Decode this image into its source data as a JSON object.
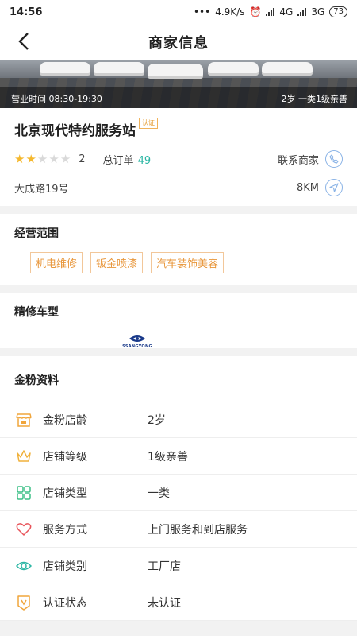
{
  "status": {
    "time": "14:56",
    "dots": "•••",
    "speed": "4.9K/s",
    "network1": "4G",
    "network2": "3G",
    "battery": "73"
  },
  "nav": {
    "title": "商家信息"
  },
  "banner": {
    "hours": "营业时间 08:30-19:30",
    "tag": "2岁 一类1级亲善"
  },
  "shop": {
    "name": "北京现代特约服务站",
    "cert_badge": "认证",
    "rating": "2",
    "stars_filled": 2,
    "stars_total": 5,
    "orders_label": "总订单",
    "orders": "49",
    "contact_label": "联系商家",
    "address": "大成路19号",
    "distance": "8KM"
  },
  "scope": {
    "title": "经营范围",
    "tags": [
      "机电维修",
      "钣金喷漆",
      "汽车装饰美容"
    ]
  },
  "models": {
    "title": "精修车型",
    "brand_text": "SSANGYONG"
  },
  "info": {
    "title": "金粉资料",
    "rows": [
      {
        "icon": "shop-icon",
        "label": "金粉店龄",
        "value": "2岁"
      },
      {
        "icon": "crown-icon",
        "label": "店铺等级",
        "value": "1级亲善"
      },
      {
        "icon": "grid-icon",
        "label": "店铺类型",
        "value": "一类"
      },
      {
        "icon": "heart-icon",
        "label": "服务方式",
        "value": "上门服务和到店服务"
      },
      {
        "icon": "eye-icon",
        "label": "店铺类别",
        "value": "工厂店"
      },
      {
        "icon": "badge-v-icon",
        "label": "认证状态",
        "value": "未认证"
      }
    ]
  },
  "colors": {
    "accent_green": "#2db7a5",
    "tag_orange": "#e8963a",
    "star": "#f5b82e",
    "icon_blue": "#8ab3e6"
  }
}
